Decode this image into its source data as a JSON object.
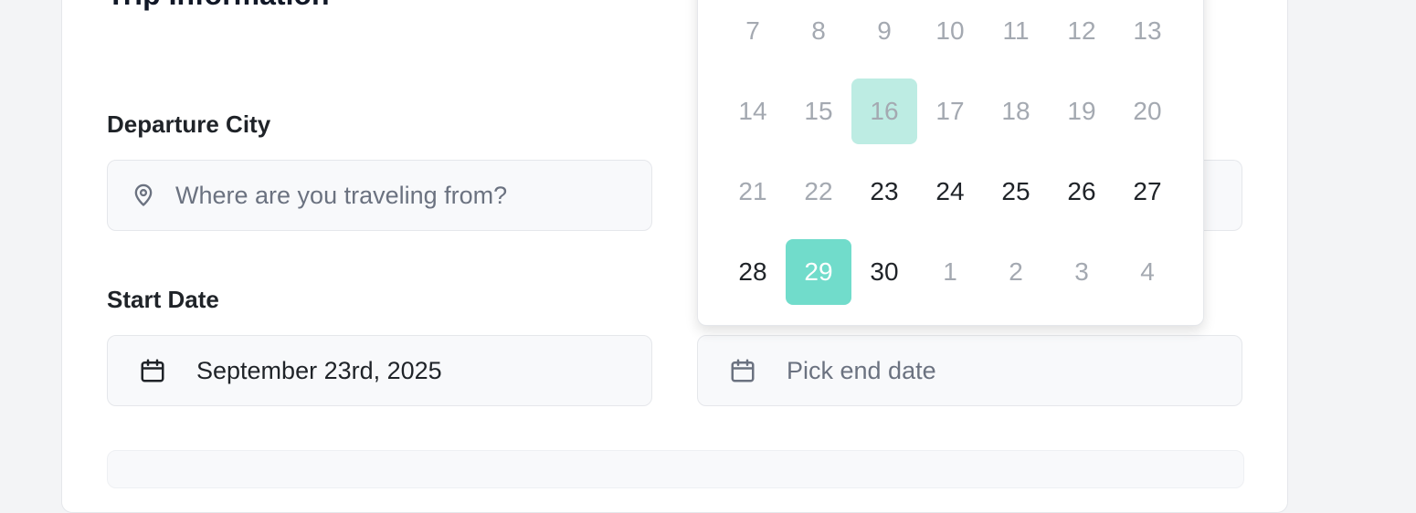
{
  "section": {
    "title": "Trip Information"
  },
  "departure": {
    "label": "Departure City",
    "placeholder": "Where are you traveling from?"
  },
  "start_date": {
    "label": "Start Date",
    "value": "September 23rd, 2025"
  },
  "end_date": {
    "placeholder": "Pick end date"
  },
  "icons": {
    "location": "map-pin-icon",
    "calendar": "calendar-icon"
  },
  "colors": {
    "accent": "#71dccb",
    "accent_light": "#bdece3",
    "muted_text": "#a4a9b1"
  },
  "calendar": {
    "weeks": [
      [
        {
          "d": "7",
          "s": "muted"
        },
        {
          "d": "8",
          "s": "muted"
        },
        {
          "d": "9",
          "s": "muted"
        },
        {
          "d": "10",
          "s": "muted"
        },
        {
          "d": "11",
          "s": "muted"
        },
        {
          "d": "12",
          "s": "muted"
        },
        {
          "d": "13",
          "s": "muted"
        }
      ],
      [
        {
          "d": "14",
          "s": "muted"
        },
        {
          "d": "15",
          "s": "muted"
        },
        {
          "d": "16",
          "s": "highlight"
        },
        {
          "d": "17",
          "s": "muted"
        },
        {
          "d": "18",
          "s": "muted"
        },
        {
          "d": "19",
          "s": "muted"
        },
        {
          "d": "20",
          "s": "muted"
        }
      ],
      [
        {
          "d": "21",
          "s": "muted"
        },
        {
          "d": "22",
          "s": "muted"
        },
        {
          "d": "23",
          "s": "normal"
        },
        {
          "d": "24",
          "s": "normal"
        },
        {
          "d": "25",
          "s": "normal"
        },
        {
          "d": "26",
          "s": "normal"
        },
        {
          "d": "27",
          "s": "normal"
        }
      ],
      [
        {
          "d": "28",
          "s": "normal"
        },
        {
          "d": "29",
          "s": "selected"
        },
        {
          "d": "30",
          "s": "normal"
        },
        {
          "d": "1",
          "s": "muted"
        },
        {
          "d": "2",
          "s": "muted"
        },
        {
          "d": "3",
          "s": "muted"
        },
        {
          "d": "4",
          "s": "muted"
        }
      ]
    ]
  }
}
